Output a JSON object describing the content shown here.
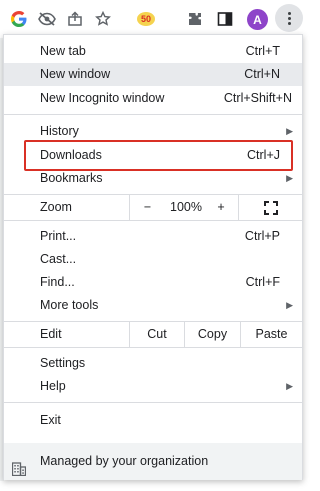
{
  "toolbar": {
    "avatar_initial": "A",
    "extension_badge": "50"
  },
  "menu": {
    "new_tab": {
      "label": "New tab",
      "shortcut": "Ctrl+T"
    },
    "new_window": {
      "label": "New window",
      "shortcut": "Ctrl+N"
    },
    "new_incognito": {
      "label": "New Incognito window",
      "shortcut": "Ctrl+Shift+N"
    },
    "history": {
      "label": "History"
    },
    "downloads": {
      "label": "Downloads",
      "shortcut": "Ctrl+J"
    },
    "bookmarks": {
      "label": "Bookmarks"
    },
    "zoom": {
      "label": "Zoom",
      "minus": "−",
      "value": "100%",
      "plus": "+"
    },
    "print": {
      "label": "Print...",
      "shortcut": "Ctrl+P"
    },
    "cast": {
      "label": "Cast..."
    },
    "find": {
      "label": "Find...",
      "shortcut": "Ctrl+F"
    },
    "more_tools": {
      "label": "More tools"
    },
    "edit": {
      "label": "Edit",
      "cut": "Cut",
      "copy": "Copy",
      "paste": "Paste"
    },
    "settings": {
      "label": "Settings"
    },
    "help": {
      "label": "Help"
    },
    "exit": {
      "label": "Exit"
    },
    "managed": {
      "label": "Managed by your organization"
    }
  },
  "colors": {
    "highlight_box": "#d93025",
    "avatar_bg": "#8e44c9",
    "hover_bg": "#e8eaed"
  }
}
